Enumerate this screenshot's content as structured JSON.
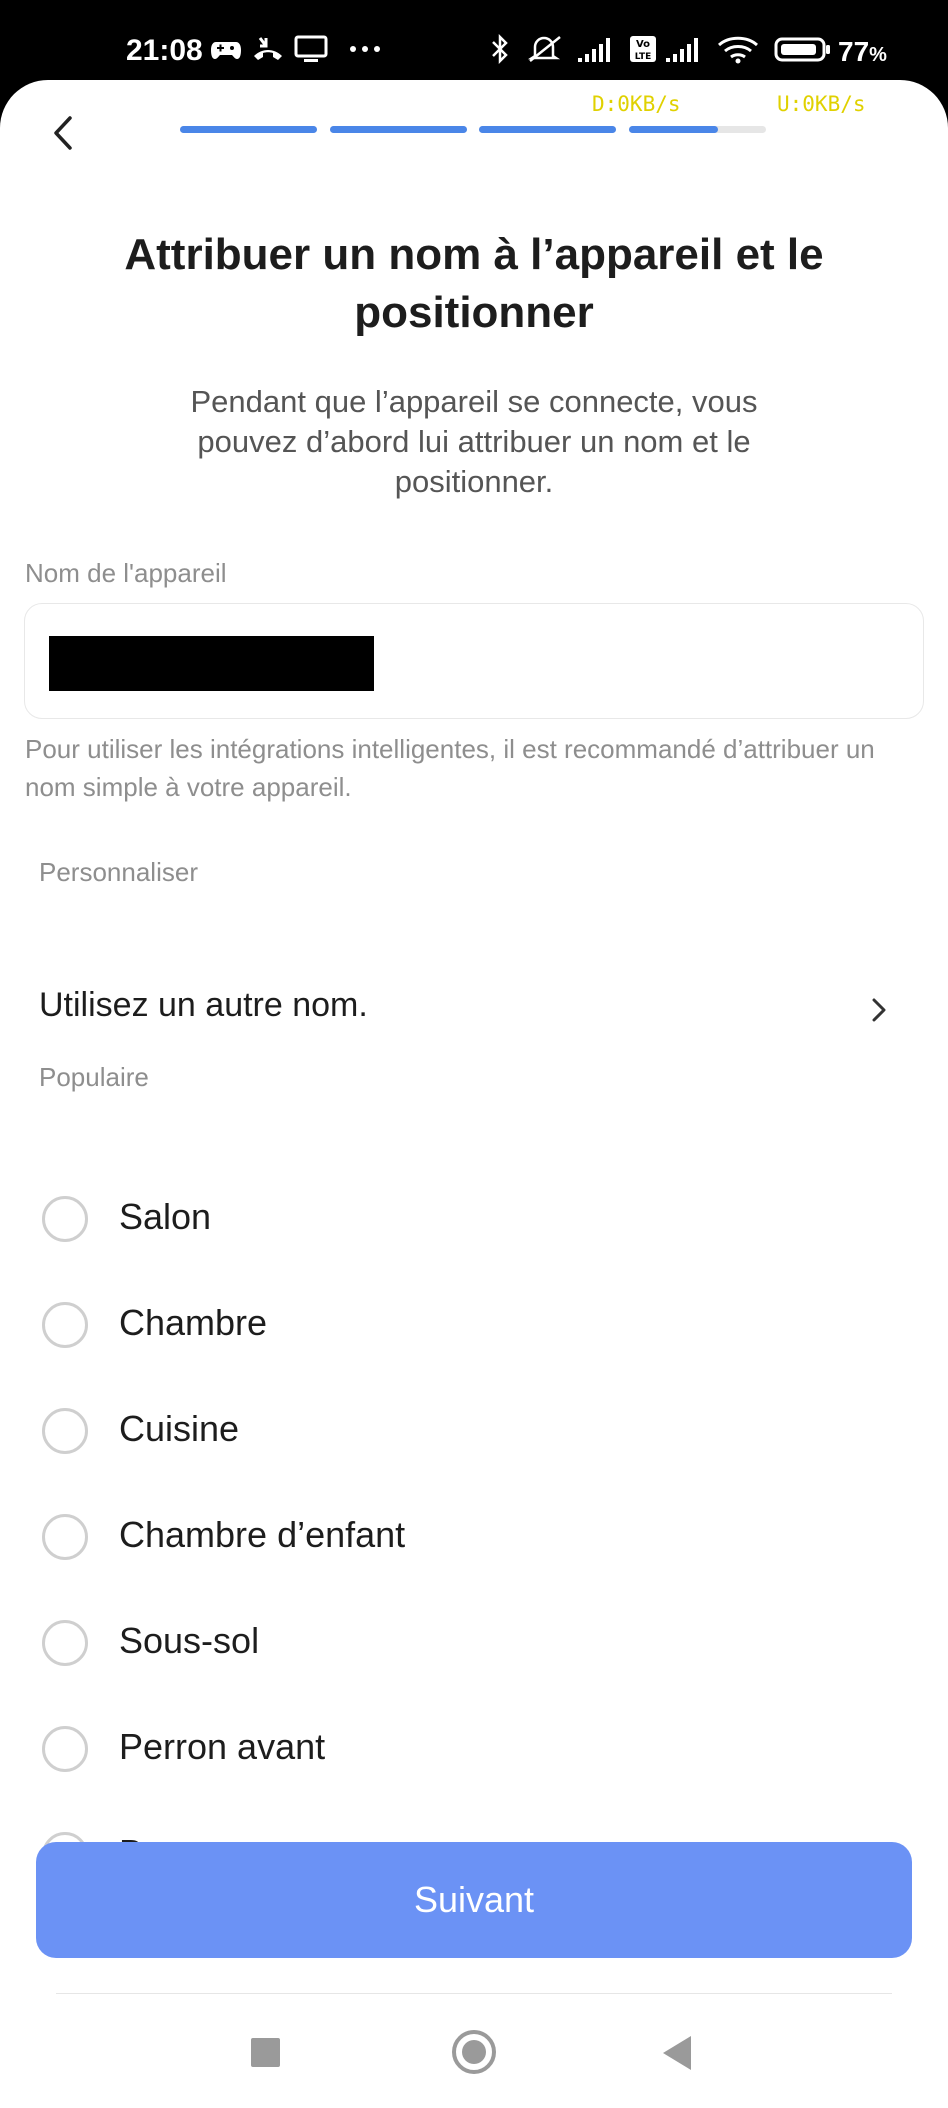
{
  "status_bar": {
    "time": "21:08",
    "battery_percent": "77",
    "battery_unit": "%",
    "left_icons": [
      "game-controller-icon",
      "call-forward-icon",
      "screen-cast-icon",
      "more-dots-icon"
    ],
    "right_icons": [
      "bluetooth-icon",
      "silent-icon",
      "signal-icon",
      "volte-icon",
      "signal-icon",
      "wifi-icon",
      "battery-icon"
    ]
  },
  "header": {
    "back_icon": "chevron-left-icon",
    "progress_segments": [
      1,
      1,
      1,
      0.65,
      0
    ],
    "download_rate": "D:0KB/s",
    "upload_rate": "U:0KB/s"
  },
  "main": {
    "title": "Attribuer un nom à l’appareil et le positionner",
    "subtitle": "Pendant que l’appareil se connecte, vous pouvez d’abord lui attribuer un nom et le positionner.",
    "name_field": {
      "label": "Nom de l'appareil",
      "value_redacted": true
    },
    "hint": "Pour utiliser les intégrations intelligentes, il est recommandé d’attribuer un nom simple à votre appareil.",
    "custom_section": {
      "label": "Personnaliser",
      "item": "Utilisez un autre nom.",
      "icon": "chevron-right-icon"
    },
    "popular_section": {
      "label": "Populaire",
      "options": [
        {
          "label": "Salon",
          "selected": false
        },
        {
          "label": "Chambre",
          "selected": false
        },
        {
          "label": "Cuisine",
          "selected": false
        },
        {
          "label": "Chambre d’enfant",
          "selected": false
        },
        {
          "label": "Sous-sol",
          "selected": false
        },
        {
          "label": "Perron avant",
          "selected": false
        },
        {
          "label": "Bureau",
          "selected": false
        }
      ]
    },
    "next_button": "Suivant"
  },
  "colors": {
    "accent": "#4a86e8",
    "button": "#6b92f5",
    "net_speed": "#e0d100"
  },
  "nav_bar": {
    "icons": [
      "recents-square-icon",
      "home-circle-icon",
      "back-triangle-icon"
    ]
  }
}
